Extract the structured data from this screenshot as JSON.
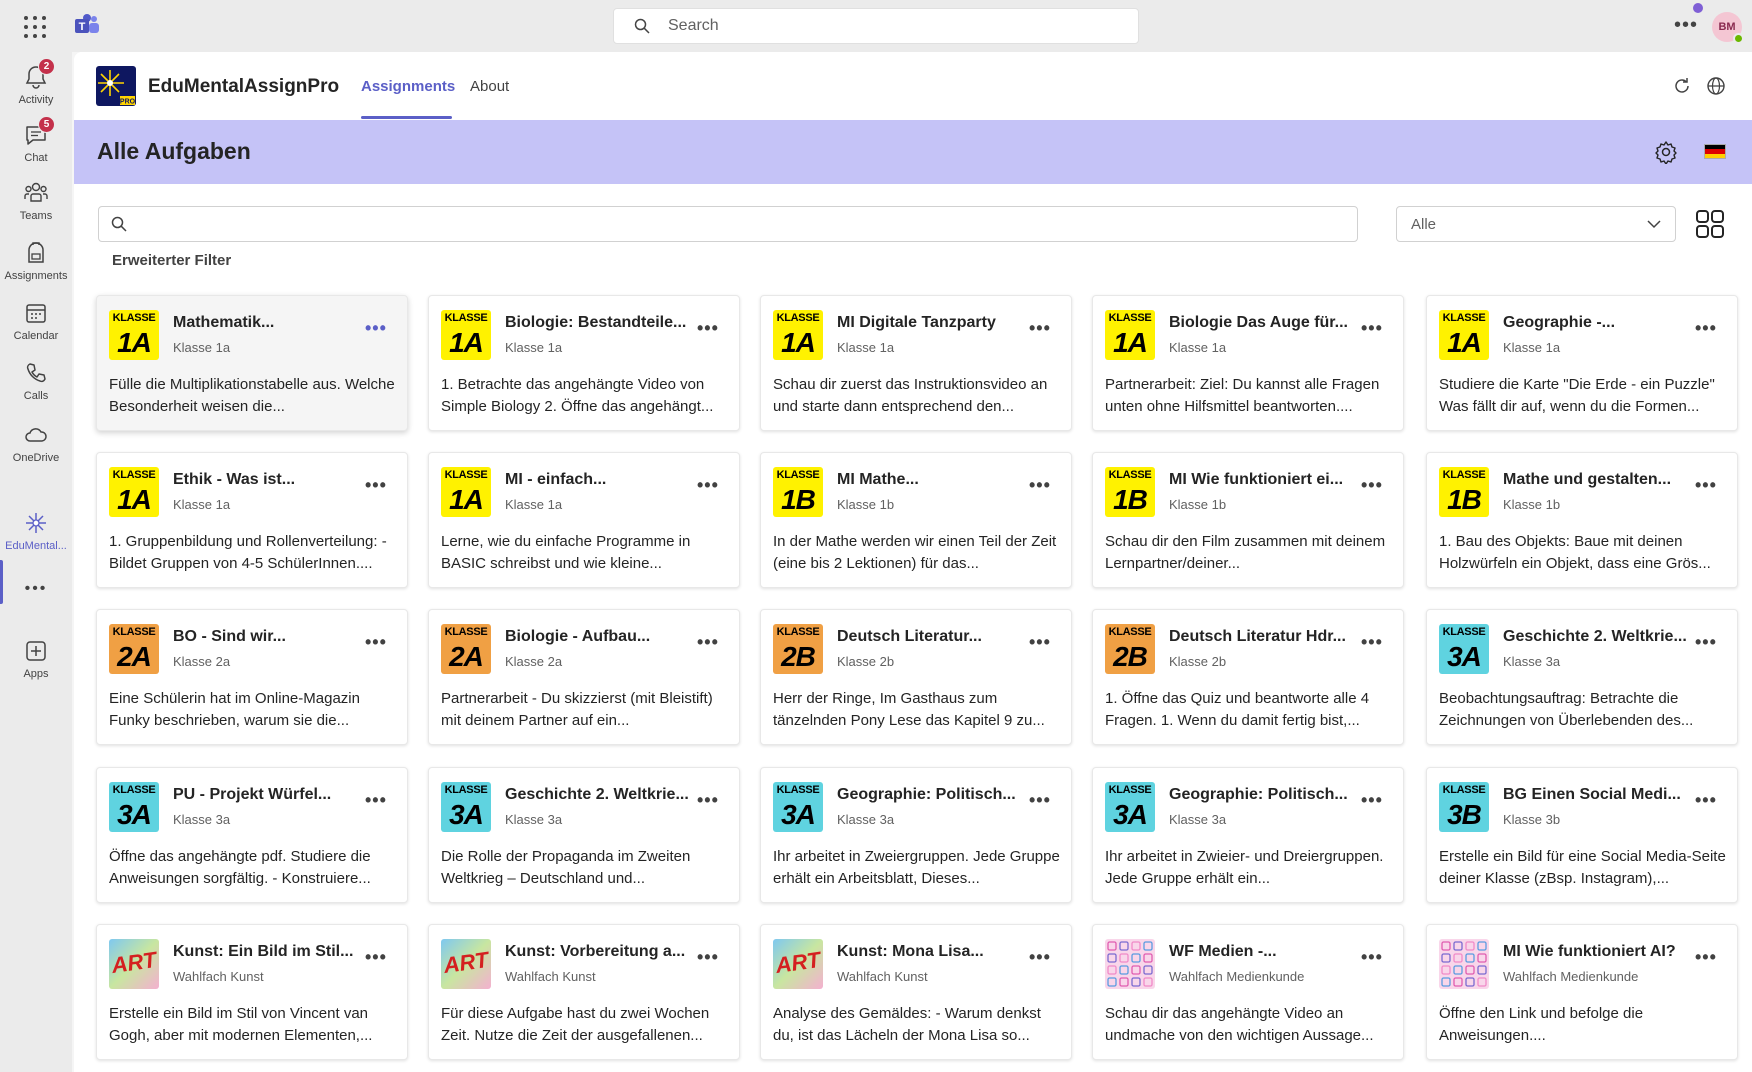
{
  "topbar": {
    "search_placeholder": "Search",
    "avatar_initials": "BM"
  },
  "rail": {
    "items": [
      {
        "label": "Activity",
        "icon": "bell-icon",
        "badge": "2"
      },
      {
        "label": "Chat",
        "icon": "chat-icon",
        "badge": "5"
      },
      {
        "label": "Teams",
        "icon": "teams-icon"
      },
      {
        "label": "Assignments",
        "icon": "backpack-icon"
      },
      {
        "label": "Calendar",
        "icon": "calendar-icon"
      },
      {
        "label": "Calls",
        "icon": "phone-icon"
      },
      {
        "label": "OneDrive",
        "icon": "cloud-icon"
      },
      {
        "label": "EduMental...",
        "icon": "edumental-icon"
      },
      {
        "label": "Apps",
        "icon": "add-app-icon"
      }
    ],
    "more_label": "•••"
  },
  "app": {
    "name": "EduMentalAssignPro",
    "tabs": [
      {
        "label": "Assignments",
        "active": true
      },
      {
        "label": "About",
        "active": false
      }
    ]
  },
  "banner": {
    "title": "Alle Aufgaben"
  },
  "filters": {
    "search_value": "",
    "select_value": "Alle",
    "advanced_label": "Erweiterter Filter"
  },
  "colors": {
    "accent": "#5b5fc7",
    "banner": "#c5c3f7",
    "klasse1": "#fff200",
    "klasse2": "#f0a044",
    "klasse3": "#5fd3e0"
  },
  "cards": [
    {
      "thumb": "klasse",
      "top": "KLASSE",
      "main": "1A",
      "bg": "#fff200",
      "title": "Mathematik...",
      "sub": "Klasse 1a",
      "desc": "Fülle die Multiplikationstabelle aus. Welche Besonderheit weisen die..."
    },
    {
      "thumb": "klasse",
      "top": "KLASSE",
      "main": "1A",
      "bg": "#fff200",
      "title": "Biologie: Bestandteile...",
      "sub": "Klasse 1a",
      "desc": "1. Betrachte das angehängte Video von Simple Biology 2. Öffne das angehängt..."
    },
    {
      "thumb": "klasse",
      "top": "KLASSE",
      "main": "1A",
      "bg": "#fff200",
      "title": "MI Digitale Tanzparty",
      "sub": "Klasse 1a",
      "desc": "Schau dir zuerst das Instruktionsvideo an und starte dann entsprechend den..."
    },
    {
      "thumb": "klasse",
      "top": "KLASSE",
      "main": "1A",
      "bg": "#fff200",
      "title": "Biologie Das Auge für...",
      "sub": "Klasse 1a",
      "desc": "Partnerarbeit: Ziel: Du kannst alle Fragen unten ohne Hilfsmittel beantworten...."
    },
    {
      "thumb": "klasse",
      "top": "KLASSE",
      "main": "1A",
      "bg": "#fff200",
      "title": "Geographie -...",
      "sub": "Klasse 1a",
      "desc": "Studiere die Karte \"Die Erde - ein Puzzle\" Was fällt dir auf, wenn du die Formen..."
    },
    {
      "thumb": "klasse",
      "top": "KLASSE",
      "main": "1A",
      "bg": "#fff200",
      "title": "Ethik - Was ist...",
      "sub": "Klasse 1a",
      "desc": "1. Gruppenbildung und Rollenverteilung: - Bildet Gruppen von 4-5 SchülerInnen...."
    },
    {
      "thumb": "klasse",
      "top": "KLASSE",
      "main": "1A",
      "bg": "#fff200",
      "title": "MI - einfach...",
      "sub": "Klasse 1a",
      "desc": "Lerne, wie du einfache Programme in BASIC schreibst und wie kleine..."
    },
    {
      "thumb": "klasse",
      "top": "KLASSE",
      "main": "1B",
      "bg": "#fff200",
      "title": "MI Mathe...",
      "sub": "Klasse 1b",
      "desc": "In der Mathe werden wir einen Teil der Zeit (eine bis 2 Lektionen) für das..."
    },
    {
      "thumb": "klasse",
      "top": "KLASSE",
      "main": "1B",
      "bg": "#fff200",
      "title": "MI Wie funktioniert ei...",
      "sub": "Klasse 1b",
      "desc": "Schau dir den Film zusammen mit deinem Lernpartner/deiner..."
    },
    {
      "thumb": "klasse",
      "top": "KLASSE",
      "main": "1B",
      "bg": "#fff200",
      "title": "Mathe und gestalten...",
      "sub": "Klasse 1b",
      "desc": "1. Bau des Objekts: Baue mit deinen Holzwürfeln ein Objekt, dass eine Grös..."
    },
    {
      "thumb": "klasse",
      "top": "KLASSE",
      "main": "2A",
      "bg": "#f0a044",
      "title": "BO - Sind wir...",
      "sub": "Klasse 2a",
      "desc": "Eine Schülerin hat im Online-Magazin Funky beschrieben, warum sie die..."
    },
    {
      "thumb": "klasse",
      "top": "KLASSE",
      "main": "2A",
      "bg": "#f0a044",
      "title": "Biologie - Aufbau...",
      "sub": "Klasse 2a",
      "desc": "Partnerarbeit - Du skizzierst (mit Bleistift) mit deinem Partner auf ein..."
    },
    {
      "thumb": "klasse",
      "top": "KLASSE",
      "main": "2B",
      "bg": "#f0a044",
      "title": "Deutsch Literatur...",
      "sub": "Klasse 2b",
      "desc": "Herr der Ringe, Im Gasthaus zum tänzelnden Pony Lese das Kapitel 9 zu..."
    },
    {
      "thumb": "klasse",
      "top": "KLASSE",
      "main": "2B",
      "bg": "#f0a044",
      "title": "Deutsch Literatur Hdr...",
      "sub": "Klasse 2b",
      "desc": "1. Öffne das Quiz und beantworte alle 4 Fragen. 1. Wenn du damit fertig bist,..."
    },
    {
      "thumb": "klasse",
      "top": "KLASSE",
      "main": "3A",
      "bg": "#5fd3e0",
      "title": "Geschichte 2. Weltkrie...",
      "sub": "Klasse 3a",
      "desc": "Beobachtungsauftrag: Betrachte die Zeichnungen von Überlebenden des..."
    },
    {
      "thumb": "klasse",
      "top": "KLASSE",
      "main": "3A",
      "bg": "#5fd3e0",
      "title": "PU - Projekt Würfel...",
      "sub": "Klasse 3a",
      "desc": "Öffne das angehängte pdf. Studiere die Anweisungen sorgfältig. - Konstruiere..."
    },
    {
      "thumb": "klasse",
      "top": "KLASSE",
      "main": "3A",
      "bg": "#5fd3e0",
      "title": "Geschichte 2. Weltkrie...",
      "sub": "Klasse 3a",
      "desc": "Die Rolle der Propaganda im Zweiten Weltkrieg – Deutschland und..."
    },
    {
      "thumb": "klasse",
      "top": "KLASSE",
      "main": "3A",
      "bg": "#5fd3e0",
      "title": "Geographie: Politisch...",
      "sub": "Klasse 3a",
      "desc": "Ihr arbeitet in Zweiergruppen. Jede Gruppe erhält ein Arbeitsblatt, Dieses..."
    },
    {
      "thumb": "klasse",
      "top": "KLASSE",
      "main": "3A",
      "bg": "#5fd3e0",
      "title": "Geographie: Politisch...",
      "sub": "Klasse 3a",
      "desc": "Ihr arbeitet in Zwieier- und Dreiergruppen. Jede Gruppe erhält ein..."
    },
    {
      "thumb": "klasse",
      "top": "KLASSE",
      "main": "3B",
      "bg": "#5fd3e0",
      "title": "BG Einen Social Medi...",
      "sub": "Klasse 3b",
      "desc": "Erstelle ein Bild für eine Social Media-Seite deiner Klasse (zBsp. Instagram),..."
    },
    {
      "thumb": "art",
      "main": "ART",
      "title": "Kunst: Ein Bild im Stil...",
      "sub": "Wahlfach Kunst",
      "desc": "Erstelle ein Bild im Stil von Vincent van Gogh, aber mit modernen Elementen,..."
    },
    {
      "thumb": "art",
      "main": "ART",
      "title": "Kunst: Vorbereitung a...",
      "sub": "Wahlfach Kunst",
      "desc": "Für diese Aufgabe hast du zwei Wochen Zeit. Nutze die Zeit der ausgefallenen..."
    },
    {
      "thumb": "art",
      "main": "ART",
      "title": "Kunst: Mona Lisa...",
      "sub": "Wahlfach Kunst",
      "desc": "Analyse des Gemäldes: - Warum denkst du, ist das Lächeln der Mona Lisa so..."
    },
    {
      "thumb": "media",
      "title": "WF Medien -...",
      "sub": "Wahlfach Medienkunde",
      "desc": "Schau dir das angehängte Video an undmache von den wichtigen Aussage..."
    },
    {
      "thumb": "media",
      "title": "MI Wie funktioniert AI?",
      "sub": "Wahlfach Medienkunde",
      "desc": "Öffne den Link und befolge die Anweisungen...."
    }
  ]
}
